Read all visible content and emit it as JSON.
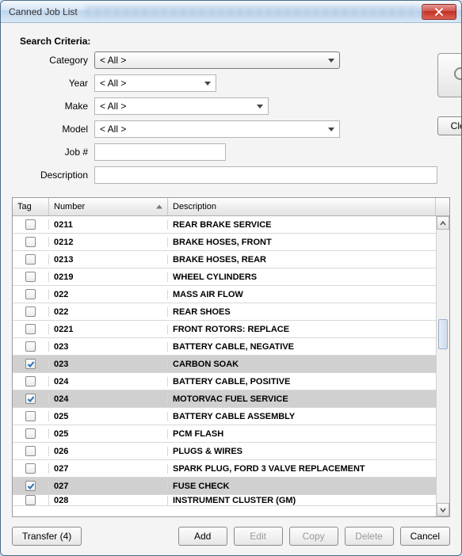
{
  "window": {
    "title": "Canned Job List"
  },
  "criteria": {
    "label": "Search Criteria:",
    "fields": {
      "category": {
        "label": "Category",
        "value": "< All >"
      },
      "year": {
        "label": "Year",
        "value": "< All >"
      },
      "make": {
        "label": "Make",
        "value": "< All >"
      },
      "model": {
        "label": "Model",
        "value": "< All >"
      },
      "job": {
        "label": "Job #",
        "value": ""
      },
      "description": {
        "label": "Description",
        "value": ""
      }
    },
    "clear": "Clear"
  },
  "grid": {
    "columns": {
      "tag": "Tag",
      "number": "Number",
      "description": "Description"
    },
    "rows": [
      {
        "tag": false,
        "num": "0211",
        "desc": "REAR BRAKE SERVICE"
      },
      {
        "tag": false,
        "num": "0212",
        "desc": "BRAKE HOSES, FRONT"
      },
      {
        "tag": false,
        "num": "0213",
        "desc": "BRAKE HOSES, REAR"
      },
      {
        "tag": false,
        "num": "0219",
        "desc": "WHEEL CYLINDERS"
      },
      {
        "tag": false,
        "num": "022",
        "desc": "MASS AIR FLOW"
      },
      {
        "tag": false,
        "num": "022",
        "desc": "REAR SHOES"
      },
      {
        "tag": false,
        "num": "0221",
        "desc": "FRONT ROTORS: REPLACE"
      },
      {
        "tag": false,
        "num": "023",
        "desc": "BATTERY CABLE, NEGATIVE"
      },
      {
        "tag": true,
        "num": "023",
        "desc": "CARBON SOAK"
      },
      {
        "tag": false,
        "num": "024",
        "desc": "BATTERY CABLE, POSITIVE"
      },
      {
        "tag": true,
        "num": "024",
        "desc": "MOTORVAC FUEL SERVICE"
      },
      {
        "tag": false,
        "num": "025",
        "desc": "BATTERY CABLE ASSEMBLY"
      },
      {
        "tag": false,
        "num": "025",
        "desc": "PCM FLASH"
      },
      {
        "tag": false,
        "num": "026",
        "desc": "PLUGS & WIRES"
      },
      {
        "tag": false,
        "num": "027",
        "desc": "SPARK PLUG, FORD 3 VALVE REPLACEMENT"
      },
      {
        "tag": true,
        "num": "027",
        "desc": "FUSE CHECK"
      },
      {
        "tag": false,
        "num": "028",
        "desc": "INSTRUMENT CLUSTER (GM)"
      }
    ]
  },
  "footer": {
    "transfer": "Transfer (4)",
    "add": "Add",
    "edit": "Edit",
    "copy": "Copy",
    "del": "Delete",
    "cancel": "Cancel"
  }
}
